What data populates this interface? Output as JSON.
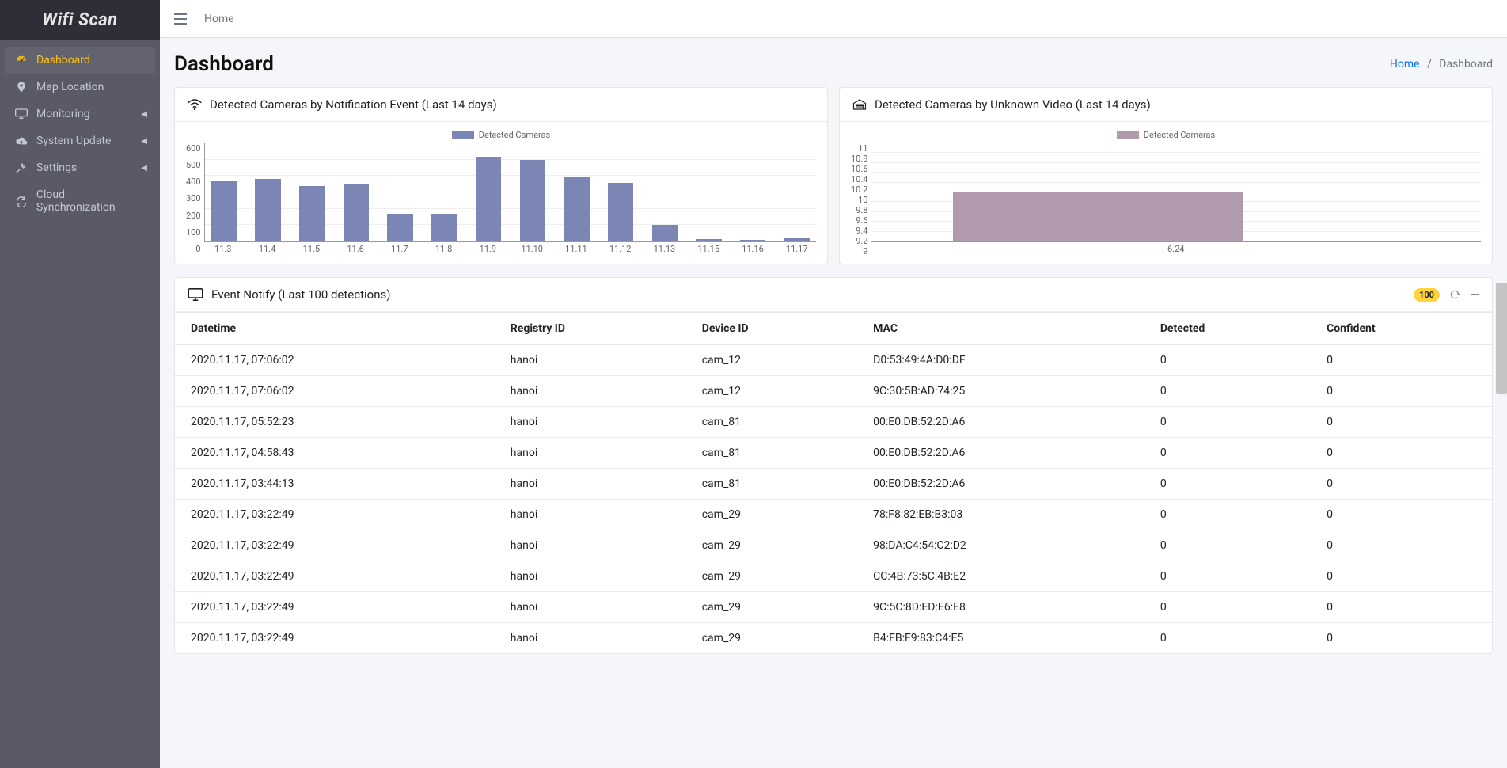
{
  "brand": "Wifi Scan",
  "topbar": {
    "home": "Home"
  },
  "sidebar": {
    "items": [
      {
        "icon": "tachometer",
        "label": "Dashboard",
        "active": true,
        "expandable": false
      },
      {
        "icon": "map-marker",
        "label": "Map Location",
        "active": false,
        "expandable": false
      },
      {
        "icon": "monitor",
        "label": "Monitoring",
        "active": false,
        "expandable": true
      },
      {
        "icon": "cloud-up",
        "label": "System Update",
        "active": false,
        "expandable": true
      },
      {
        "icon": "tools",
        "label": "Settings",
        "active": false,
        "expandable": true
      },
      {
        "icon": "sync",
        "label": "Cloud Synchronization",
        "active": false,
        "expandable": false
      }
    ]
  },
  "page": {
    "title": "Dashboard",
    "breadcrumb": {
      "home": "Home",
      "sep": "/",
      "current": "Dashboard"
    }
  },
  "cards": {
    "left": {
      "title": "Detected Cameras by Notification Event (Last 14 days)",
      "legend": "Detected Cameras",
      "color": "#7b86b5"
    },
    "right": {
      "title": "Detected Cameras by Unknown Video (Last 14 days)",
      "legend": "Detected Cameras",
      "color": "#b19aae"
    },
    "events": {
      "title": "Event Notify (Last 100 detections)",
      "badge": "100"
    }
  },
  "chart_data": [
    {
      "type": "bar",
      "title": "Detected Cameras by Notification Event (Last 14 days)",
      "legend": "Detected Cameras",
      "categories": [
        "11.3",
        "11.4",
        "11.5",
        "11.6",
        "11.7",
        "11.8",
        "11.9",
        "11.10",
        "11.11",
        "11.12",
        "11.13",
        "11.15",
        "11.16",
        "11.17"
      ],
      "values": [
        370,
        380,
        340,
        350,
        170,
        170,
        520,
        500,
        390,
        360,
        100,
        15,
        10,
        25
      ],
      "ylim": [
        0,
        600
      ],
      "yticks": [
        0,
        100,
        200,
        300,
        400,
        500,
        600
      ],
      "color": "#7b86b5"
    },
    {
      "type": "bar",
      "title": "Detected Cameras by Unknown Video (Last 14 days)",
      "legend": "Detected Cameras",
      "categories": [
        "6.24"
      ],
      "values": [
        10.0
      ],
      "ylim": [
        9.0,
        11.0
      ],
      "yticks": [
        9.0,
        9.2,
        9.4,
        9.6,
        9.8,
        10.0,
        10.2,
        10.4,
        10.6,
        10.8,
        11.0
      ],
      "color": "#b19aae"
    }
  ],
  "table": {
    "headers": [
      "Datetime",
      "Registry ID",
      "Device ID",
      "MAC",
      "Detected",
      "Confident"
    ],
    "rows": [
      [
        "2020.11.17, 07:06:02",
        "hanoi",
        "cam_12",
        "D0:53:49:4A:D0:DF",
        "0",
        "0"
      ],
      [
        "2020.11.17, 07:06:02",
        "hanoi",
        "cam_12",
        "9C:30:5B:AD:74:25",
        "0",
        "0"
      ],
      [
        "2020.11.17, 05:52:23",
        "hanoi",
        "cam_81",
        "00:E0:DB:52:2D:A6",
        "0",
        "0"
      ],
      [
        "2020.11.17, 04:58:43",
        "hanoi",
        "cam_81",
        "00:E0:DB:52:2D:A6",
        "0",
        "0"
      ],
      [
        "2020.11.17, 03:44:13",
        "hanoi",
        "cam_81",
        "00:E0:DB:52:2D:A6",
        "0",
        "0"
      ],
      [
        "2020.11.17, 03:22:49",
        "hanoi",
        "cam_29",
        "78:F8:82:EB:B3:03",
        "0",
        "0"
      ],
      [
        "2020.11.17, 03:22:49",
        "hanoi",
        "cam_29",
        "98:DA:C4:54:C2:D2",
        "0",
        "0"
      ],
      [
        "2020.11.17, 03:22:49",
        "hanoi",
        "cam_29",
        "CC:4B:73:5C:4B:E2",
        "0",
        "0"
      ],
      [
        "2020.11.17, 03:22:49",
        "hanoi",
        "cam_29",
        "9C:5C:8D:ED:E6:E8",
        "0",
        "0"
      ],
      [
        "2020.11.17, 03:22:49",
        "hanoi",
        "cam_29",
        "B4:FB:F9:83:C4:E5",
        "0",
        "0"
      ]
    ]
  }
}
